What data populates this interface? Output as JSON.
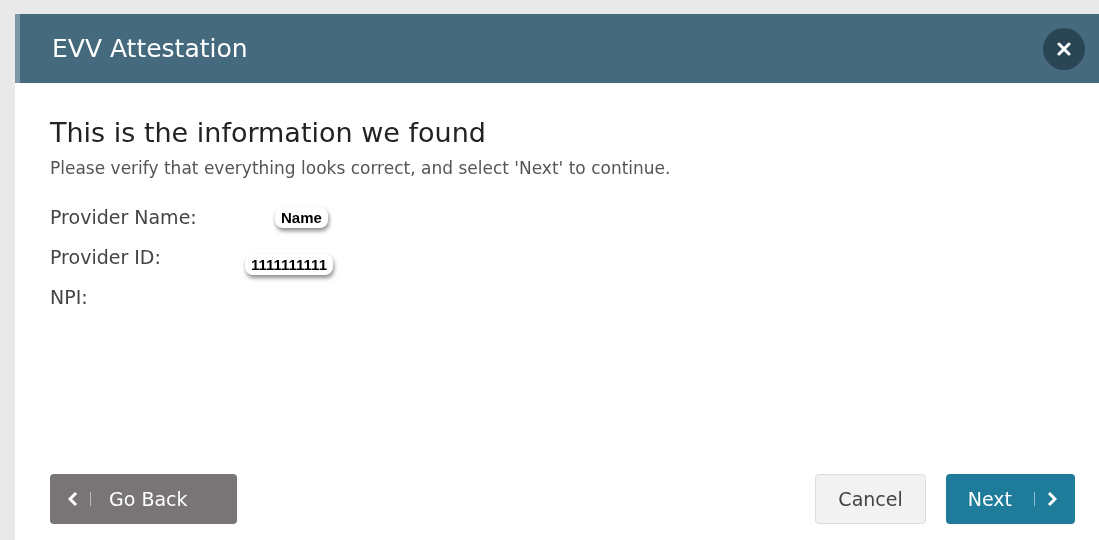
{
  "dialog": {
    "title": "EVV Attestation"
  },
  "heading": "This is the information we found",
  "instruction": "Please verify that everything looks correct, and select 'Next' to continue.",
  "fields": [
    {
      "label": "Provider Name:",
      "value": "Name"
    },
    {
      "label": "Provider ID:",
      "value": "1111111111"
    },
    {
      "label": "NPI:"
    }
  ],
  "buttons": {
    "back": "Go Back",
    "cancel": "Cancel",
    "next": "Next"
  }
}
